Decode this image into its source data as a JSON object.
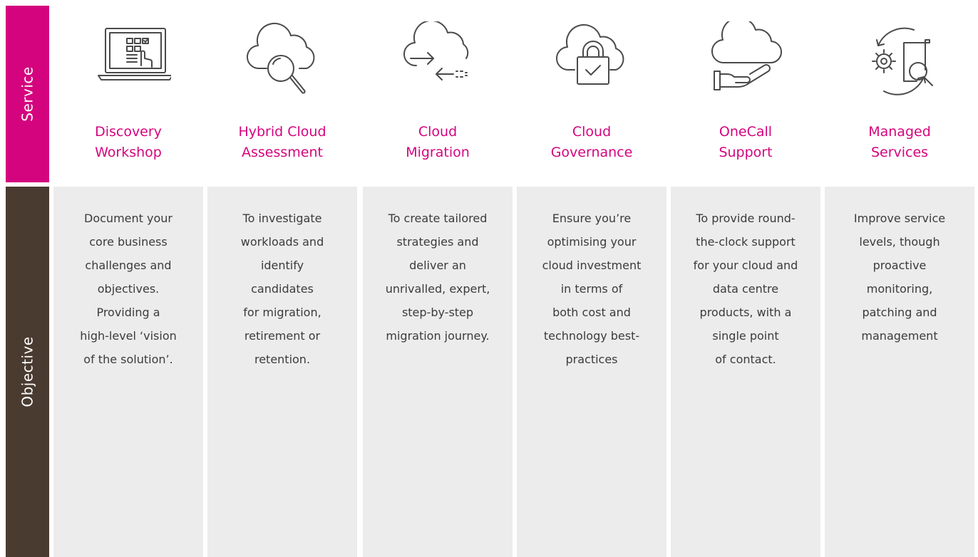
{
  "labels": {
    "service": "Service",
    "objective": "Objective"
  },
  "columns": [
    {
      "icon": "laptop-checklist-icon",
      "title": "Discovery\nWorkshop",
      "objective": "Document your\ncore business\nchallenges and\nobjectives.\nProviding a\nhigh-level ‘vision\nof the solution’."
    },
    {
      "icon": "cloud-search-icon",
      "title": "Hybrid Cloud\nAssessment",
      "objective": "To investigate\nworkloads and\nidentify\ncandidates\nfor migration,\nretirement or\nretention."
    },
    {
      "icon": "cloud-migration-icon",
      "title": "Cloud\nMigration",
      "objective": "To create tailored\nstrategies and\ndeliver an\nunrivalled, expert,\nstep-by-step\nmigration journey."
    },
    {
      "icon": "cloud-padlock-icon",
      "title": "Cloud\nGovernance",
      "objective": "Ensure you’re\noptimising your\ncloud investment\nin terms of\nboth cost and\ntechnology best-\npractices"
    },
    {
      "icon": "cloud-hand-icon",
      "title": "OneCall\nSupport",
      "objective": "To provide round-\nthe-clock support\nfor your cloud and\ndata centre\nproducts, with a\nsingle point\nof contact."
    },
    {
      "icon": "gear-document-search-icon",
      "title": "Managed\nServices",
      "objective": "Improve service\nlevels, though\nproactive\nmonitoring,\npatching and\nmanagement"
    }
  ]
}
